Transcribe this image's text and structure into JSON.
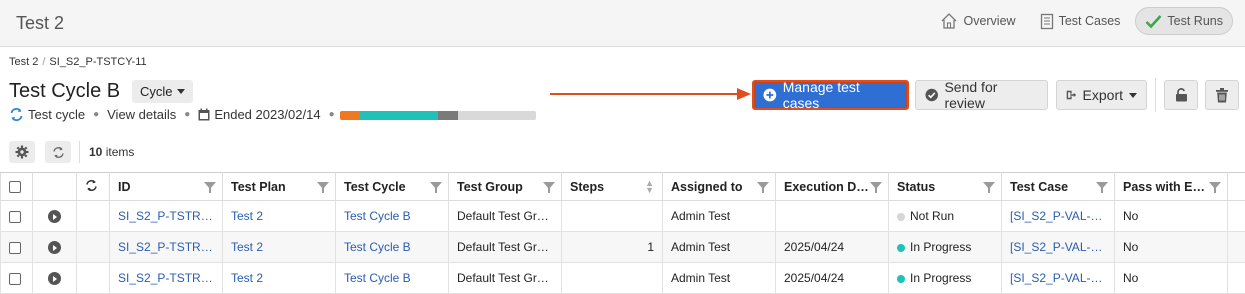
{
  "topbar": {
    "title": "Test 2",
    "nav": [
      {
        "label": "Overview",
        "icon": "home-icon",
        "active": false
      },
      {
        "label": "Test Cases",
        "icon": "document-icon",
        "active": false
      },
      {
        "label": "Test Runs",
        "icon": "checkmark-icon",
        "active": true
      }
    ]
  },
  "breadcrumb": [
    "Test 2",
    "SI_S2_P-TSTCY-11"
  ],
  "header": {
    "title": "Test Cycle B",
    "type_dropdown": "Cycle",
    "meta": {
      "type_label": "Test cycle",
      "details_link": "View details",
      "ended": "Ended 2023/02/14"
    },
    "progress": [
      {
        "fraction": 0.1,
        "color": "#f07820"
      },
      {
        "fraction": 0.4,
        "color": "#1fc1b8"
      },
      {
        "fraction": 0.1,
        "color": "#7a7a7a"
      },
      {
        "fraction": 0.4,
        "color": "#d9d9d9"
      }
    ],
    "colors": {
      "primary": "#2f6fd4",
      "highlight": "#e04d1f",
      "link": "#2a5db0"
    }
  },
  "actions": {
    "manage": "Manage test cases",
    "review": "Send for review",
    "export": "Export"
  },
  "toolbar": {
    "count": "10",
    "count_suffix": "items"
  },
  "table": {
    "columns": [
      "ID",
      "Test Plan",
      "Test Cycle",
      "Test Group",
      "Steps",
      "Assigned to",
      "Execution D…",
      "Status",
      "Test Case",
      "Pass with E…"
    ],
    "rows": [
      {
        "id": "SI_S2_P-TSTR…",
        "plan": "Test 2",
        "cycle": "Test Cycle B",
        "group": "Default Test Gr…",
        "steps": "",
        "assigned": "Admin Test",
        "exec": "",
        "status": "Not Run",
        "status_color": "#d6d6d6",
        "case": "[SI_S2_P-VAL-…",
        "pass": "No"
      },
      {
        "id": "SI_S2_P-TSTR…",
        "plan": "Test 2",
        "cycle": "Test Cycle B",
        "group": "Default Test Gr…",
        "steps": "1",
        "assigned": "Admin Test",
        "exec": "2025/04/24",
        "status": "In Progress",
        "status_color": "#1fc1b8",
        "case": "[SI_S2_P-VAL-…",
        "pass": "No"
      },
      {
        "id": "SI_S2_P-TSTR…",
        "plan": "Test 2",
        "cycle": "Test Cycle B",
        "group": "Default Test Gr…",
        "steps": "",
        "assigned": "Admin Test",
        "exec": "2025/04/24",
        "status": "In Progress",
        "status_color": "#1fc1b8",
        "case": "[SI_S2_P-VAL-…",
        "pass": "No"
      }
    ]
  }
}
